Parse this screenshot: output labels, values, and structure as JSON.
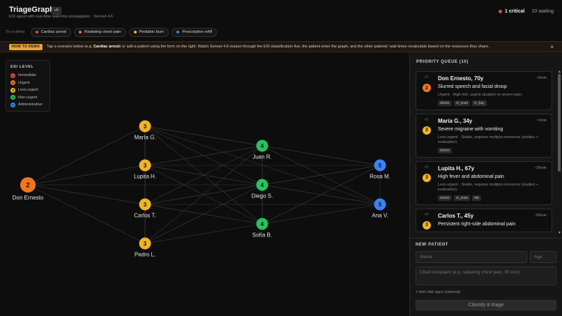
{
  "header": {
    "title": "TriageGraph",
    "version": "v8",
    "subtitle": "ESI agent with real-time wait-time propagation · Sonnet 4.6",
    "critical_label": "1 critical",
    "waiting_label": "10 waiting"
  },
  "demo": {
    "label": "Try a demo",
    "chips": [
      {
        "label": "Cardiac arrest",
        "color": "#e5484d"
      },
      {
        "label": "Radiating chest pain",
        "color": "#f5761a"
      },
      {
        "label": "Pediatric burn",
        "color": "#f0b429"
      },
      {
        "label": "Prescription refill",
        "color": "#3b82f6"
      }
    ]
  },
  "banner": {
    "badge": "HOW TO DEMO",
    "text_before": "Tap a scenario below (e.g. ",
    "text_bold": "Cardiac arrest",
    "text_after": ") or add a patient using the form on the right. Watch Sonnet 4.6 reason through the ESI classification live, the patient enter the graph, and the other patients' wait times recalculate based on the resources they share.",
    "close": "×"
  },
  "legend": {
    "title": "ESI LEVEL",
    "items": [
      {
        "level": "1",
        "label": "Immediate",
        "color": "#e5484d"
      },
      {
        "level": "2",
        "label": "Urgent",
        "color": "#f5761a"
      },
      {
        "level": "3",
        "label": "Less urgent",
        "color": "#f0b429"
      },
      {
        "level": "4",
        "label": "Non-urgent",
        "color": "#22c55e"
      },
      {
        "level": "5",
        "label": "Administrative",
        "color": "#3b82f6"
      }
    ]
  },
  "graph": {
    "nodes": [
      {
        "id": "ernesto",
        "name": "Don Ernesto",
        "level": "2",
        "color": "#f5761a",
        "big": true
      },
      {
        "id": "maria",
        "name": "María G.",
        "level": "3",
        "color": "#f0b429"
      },
      {
        "id": "lupita",
        "name": "Lupita H.",
        "level": "3",
        "color": "#f0b429"
      },
      {
        "id": "carlos",
        "name": "Carlos T.",
        "level": "3",
        "color": "#f0b429"
      },
      {
        "id": "pedro",
        "name": "Pedro L.",
        "level": "3",
        "color": "#f0b429"
      },
      {
        "id": "juan",
        "name": "Juan R.",
        "level": "4",
        "color": "#22c55e"
      },
      {
        "id": "diego",
        "name": "Diego S.",
        "level": "4",
        "color": "#22c55e"
      },
      {
        "id": "sofia",
        "name": "Sofía B.",
        "level": "4",
        "color": "#22c55e"
      },
      {
        "id": "rosa",
        "name": "Rosa M.",
        "level": "5",
        "color": "#3b82f6"
      },
      {
        "id": "ana",
        "name": "Ana V.",
        "level": "5",
        "color": "#3b82f6"
      }
    ]
  },
  "queue": {
    "title": "PRIORITY QUEUE (10)",
    "items": [
      {
        "rank": "#1",
        "level": "2",
        "color": "#f5761a",
        "name": "Don Ernesto, 70y",
        "time": "~0min",
        "complaint": "Slurred speech and facial droop",
        "desc": "Urgent · High risk; urgent situation or severe pain.",
        "tags": [
          "doctor",
          "ct_scan",
          "iv_bay"
        ]
      },
      {
        "rank": "#2",
        "level": "3",
        "color": "#f0b429",
        "name": "María G., 34y",
        "time": "~0min",
        "complaint": "Severe migraine with vomiting",
        "desc": "Less urgent · Stable, requires multiple resources (studies + evaluation).",
        "tags": [
          "doctor"
        ]
      },
      {
        "rank": "#3",
        "level": "3",
        "color": "#f0b429",
        "name": "Lupita H., 67y",
        "time": "~26min",
        "complaint": "High fever and abdominal pain",
        "desc": "Less urgent · Stable, requires multiple resources (studies + evaluation).",
        "tags": [
          "doctor",
          "ct_scan",
          "lab"
        ]
      },
      {
        "rank": "#4",
        "level": "3",
        "color": "#f0b429",
        "name": "Carlos T., 45y",
        "time": "~50min",
        "complaint": "Persistent right-side abdominal pain",
        "desc": "",
        "tags": []
      }
    ]
  },
  "new_patient": {
    "title": "NEW PATIENT",
    "name_placeholder": "Name",
    "age_placeholder": "Age",
    "complaint_placeholder": "Chief complaint (e.g. radiating chest pain, 30 min)",
    "vitals_link": "+ Add vital signs (optional)",
    "submit_label": "Classify & triage"
  }
}
